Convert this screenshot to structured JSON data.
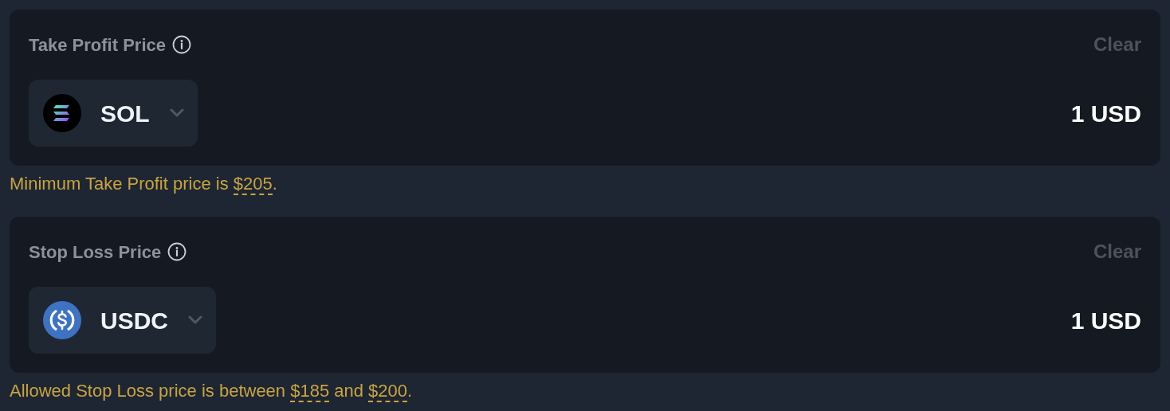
{
  "sections": [
    {
      "label": "Take Profit Price",
      "clear": "Clear",
      "token": {
        "symbol": "SOL",
        "kind": "sol"
      },
      "value": "1 USD",
      "hint": [
        {
          "kind": "text",
          "text": "Minimum Take Profit price is "
        },
        {
          "kind": "price",
          "text": "$205"
        },
        {
          "kind": "text",
          "text": "."
        }
      ]
    },
    {
      "label": "Stop Loss Price",
      "clear": "Clear",
      "token": {
        "symbol": "USDC",
        "kind": "usdc"
      },
      "value": "1 USD",
      "hint": [
        {
          "kind": "text",
          "text": "Allowed Stop Loss price is between "
        },
        {
          "kind": "price",
          "text": "$185"
        },
        {
          "kind": "text",
          "text": " and "
        },
        {
          "kind": "price",
          "text": "$200"
        },
        {
          "kind": "text",
          "text": "."
        }
      ]
    }
  ]
}
